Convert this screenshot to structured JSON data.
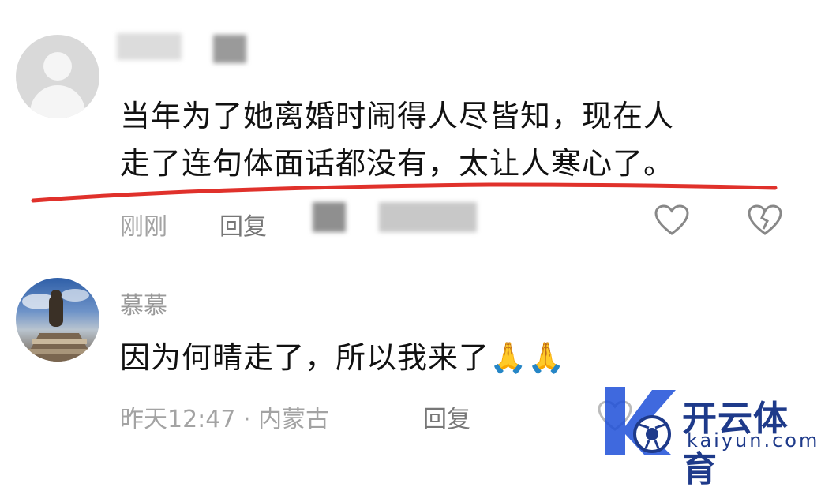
{
  "comments": [
    {
      "username": "",
      "text_line1": "当年为了她离婚时闹得人尽皆知，现在人",
      "text_line2": "走了连句体面话都没有，太让人寒心了。",
      "time": "刚刚",
      "reply_label": "回复"
    },
    {
      "username": "慕慕",
      "text": "因为何晴走了，所以我来了",
      "emoji": "🙏🙏",
      "time_location": "昨天12:47 · 内蒙古",
      "reply_label": "回复"
    }
  ],
  "watermark": {
    "cn": "开云体育",
    "en": "kaiyun.com"
  },
  "colors": {
    "underline": "#e0312b",
    "meta_gray": "#a3a3a3",
    "brand_blue": "#1e3a8a"
  }
}
